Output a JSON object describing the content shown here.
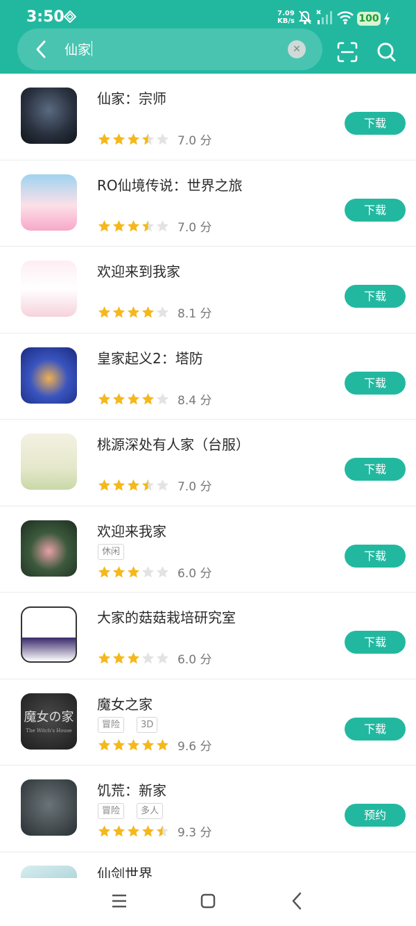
{
  "status_bar": {
    "time": "3:50",
    "net_speed_value": "7.09",
    "net_speed_unit": "KB/s",
    "battery": "100"
  },
  "search": {
    "query": "仙家"
  },
  "colors": {
    "accent": "#22b8a0",
    "star_on": "#f5b81c",
    "star_off": "#e3e3e3"
  },
  "results": [
    {
      "title": "仙家：宗师",
      "tags": [],
      "rating": 7.0,
      "stars": 3.5,
      "score": "7.0 分",
      "action": "下载",
      "icon": "dark-dragon-art"
    },
    {
      "title": "RO仙境传说：世界之旅",
      "tags": [],
      "rating": 7.0,
      "stars": 3.5,
      "score": "7.0 分",
      "action": "下载",
      "icon": "anime-girl-pink-pet"
    },
    {
      "title": "欢迎来到我家",
      "tags": [],
      "rating": 8.1,
      "stars": 4,
      "score": "8.1 分",
      "action": "下载",
      "icon": "white-cat-girl"
    },
    {
      "title": "皇家起义2：塔防",
      "tags": [],
      "rating": 8.4,
      "stars": 4,
      "score": "8.4 分",
      "action": "下载",
      "icon": "crowned-boy"
    },
    {
      "title": "桃源深处有人家（台服）",
      "tags": [],
      "rating": 7.0,
      "stars": 3.5,
      "score": "7.0 分",
      "action": "下载",
      "icon": "white-ghost-sprite"
    },
    {
      "title": "欢迎来我家",
      "tags": [
        "休闲"
      ],
      "rating": 6.0,
      "stars": 3,
      "score": "6.0 分",
      "action": "下载",
      "icon": "forest-bunny-girl"
    },
    {
      "title": "大家的菇菇栽培研究室",
      "tags": [],
      "rating": 6.0,
      "stars": 3,
      "score": "6.0 分",
      "action": "下载",
      "icon": "mushroom-character"
    },
    {
      "title": "魔女之家",
      "tags": [
        "冒险",
        "3D"
      ],
      "rating": 9.6,
      "stars": 5,
      "score": "9.6 分",
      "action": "下载",
      "icon": "witch-house-title",
      "icon_text": "魔女の家",
      "icon_subtext": "The Witch's House"
    },
    {
      "title": "饥荒：新家",
      "tags": [
        "冒险",
        "多人"
      ],
      "rating": 9.3,
      "stars": 4.5,
      "score": "9.3 分",
      "action": "预约",
      "icon": "dont-starve-characters"
    }
  ],
  "partial_result": {
    "title": "仙剑世界",
    "icon": "teal-landscape"
  },
  "navbar": {
    "items": [
      "menu-icon",
      "home-icon",
      "back-icon"
    ]
  }
}
